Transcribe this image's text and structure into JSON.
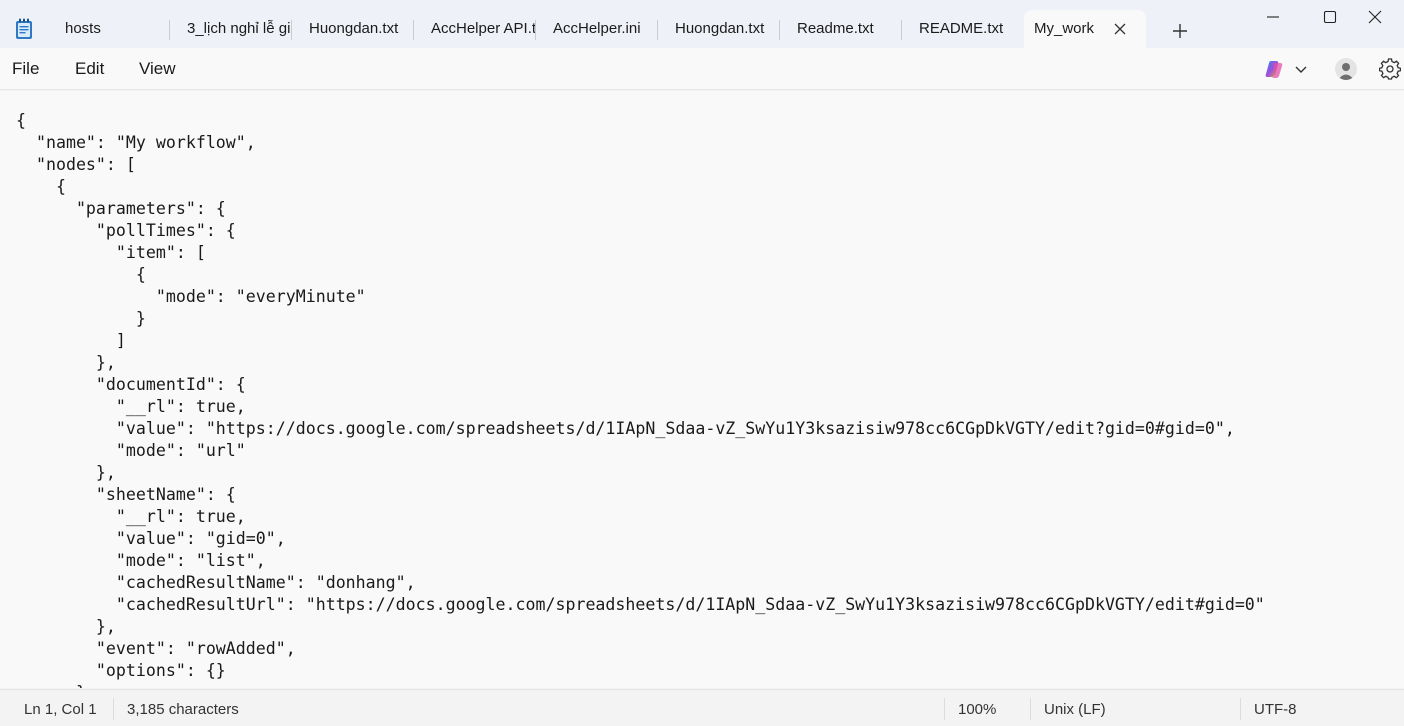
{
  "tabs": [
    {
      "label": "hosts"
    },
    {
      "label": "3_lịch nghỉ lễ gi"
    },
    {
      "label": "Huongdan.txt"
    },
    {
      "label": "AccHelper API.t"
    },
    {
      "label": "AccHelper.ini"
    },
    {
      "label": "Huongdan.txt"
    },
    {
      "label": "Readme.txt"
    },
    {
      "label": "README.txt"
    },
    {
      "label": "My_work",
      "active": true
    }
  ],
  "menu": {
    "file": "File",
    "edit": "Edit",
    "view": "View"
  },
  "editor": {
    "lines": [
      "{",
      "  \"name\": \"My workflow\",",
      "  \"nodes\": [",
      "    {",
      "      \"parameters\": {",
      "        \"pollTimes\": {",
      "          \"item\": [",
      "            {",
      "              \"mode\": \"everyMinute\"",
      "            }",
      "          ]",
      "        },",
      "        \"documentId\": {",
      "          \"__rl\": true,",
      "          \"value\": \"https://docs.google.com/spreadsheets/d/1IApN_Sdaa-vZ_SwYu1Y3ksazisiw978cc6CGpDkVGTY/edit?gid=0#gid=0\",",
      "          \"mode\": \"url\"",
      "        },",
      "        \"sheetName\": {",
      "          \"__rl\": true,",
      "          \"value\": \"gid=0\",",
      "          \"mode\": \"list\",",
      "          \"cachedResultName\": \"donhang\",",
      "          \"cachedResultUrl\": \"https://docs.google.com/spreadsheets/d/1IApN_Sdaa-vZ_SwYu1Y3ksazisiw978cc6CGpDkVGTY/edit#gid=0\"",
      "        },",
      "        \"event\": \"rowAdded\",",
      "        \"options\": {}",
      "      },"
    ]
  },
  "status": {
    "position": "Ln 1, Col 1",
    "characters": "3,185 characters",
    "zoom": "100%",
    "line_ending": "Unix (LF)",
    "encoding": "UTF-8"
  },
  "colors": {
    "titlebar": "#eef1f7",
    "editor_bg": "#f9f9f9",
    "app_icon": "#1f6fb8"
  },
  "icons": [
    "notepad-app-icon",
    "close-icon",
    "plus-icon",
    "minimize-icon",
    "maximize-icon",
    "window-close-icon",
    "copilot-icon",
    "chevron-down-icon",
    "account-icon",
    "gear-icon"
  ]
}
